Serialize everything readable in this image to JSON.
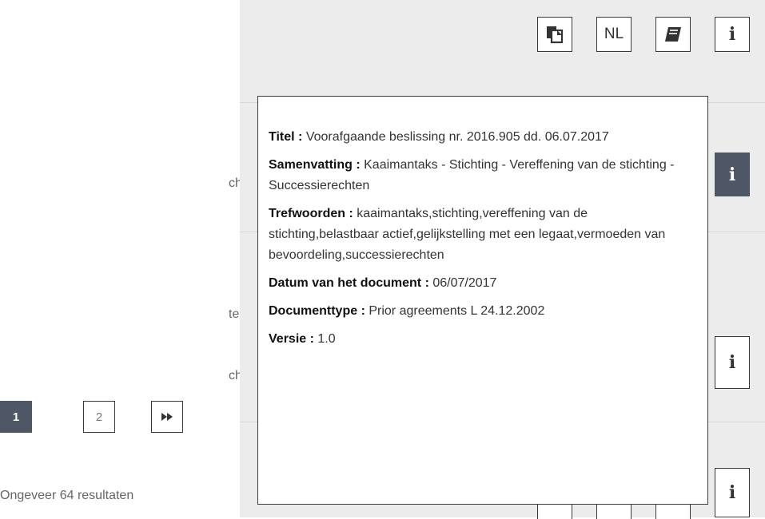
{
  "toolbar": {
    "lang_label": "NL"
  },
  "tooltip": {
    "rows": [
      {
        "key": "Titel :",
        "value": " Voorafgaande beslissing nr. 2016.905 dd. 06.07.2017"
      },
      {
        "key": "Samenvatting :",
        "value": " Kaaimantaks - Stichting - Vereffening van de stichting - Successierechten"
      },
      {
        "key": "Trefwoorden :",
        "value": " kaaimantaks,stichting,vereffening van de stichting,belastbaar actief,gelijkstelling met een legaat,vermoeden van bevoordeling,successierechten"
      },
      {
        "key": "Datum van het document :",
        "value": " 06/07/2017"
      },
      {
        "key": "Documenttype :",
        "value": " Prior agreements L 24.12.2002"
      },
      {
        "key": "Versie :",
        "value": " 1.0"
      }
    ]
  },
  "background_fragments": [
    "cht",
    "ter",
    "cht"
  ],
  "pagination": {
    "current": "1",
    "page2": "2",
    "next_icon": "fast-forward-icon"
  },
  "results_text": "Ongeveer 64 resultaten",
  "info_symbol": "i",
  "colors": {
    "panel_bg": "#ececec",
    "active": "#4f5766",
    "border": "#3a3a3a"
  }
}
